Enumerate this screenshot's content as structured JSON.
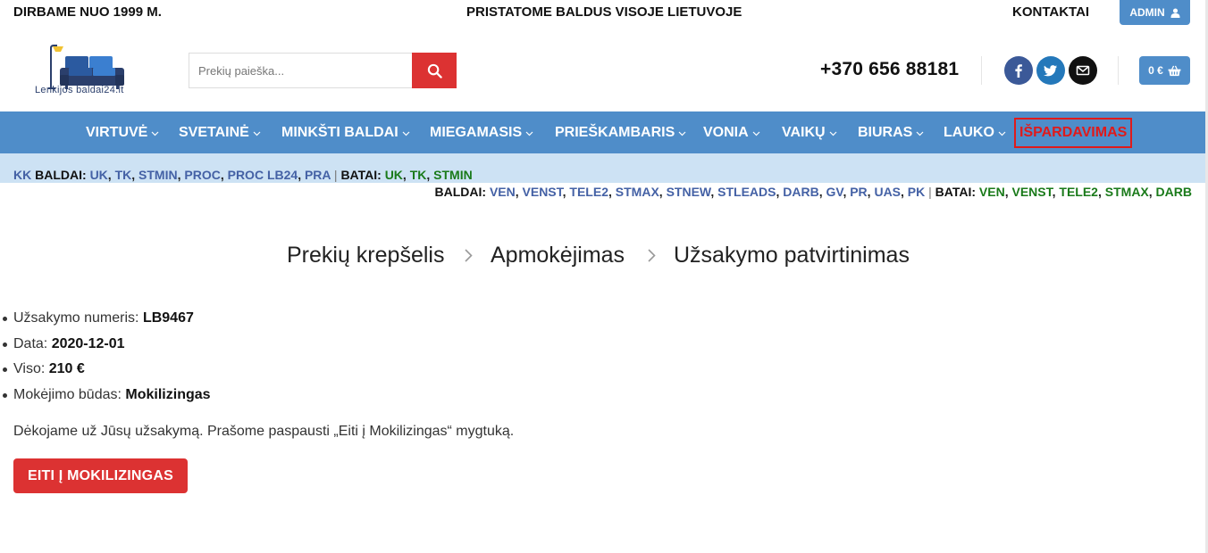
{
  "topbar": {
    "left_text": "DIRBAME NUO 1999 M.",
    "center_text": "PRISTATOME BALDUS VISOJE LIETUVOJE",
    "contacts_label": "KONTAKTAI",
    "admin_label": "ADMIN"
  },
  "header": {
    "logo_text": "Lenkijos baldai24.lt",
    "search_placeholder": "Prekių paieška...",
    "phone": "+370 656 88181",
    "cart_total": "0 €"
  },
  "nav": {
    "items": [
      {
        "label": "VIRTUVĖ"
      },
      {
        "label": "SVETAINĖ"
      },
      {
        "label": "MINKŠTI BALDAI"
      },
      {
        "label": "MIEGAMASIS"
      },
      {
        "label": "PRIEŠKAMBARIS"
      },
      {
        "label": "VONIA"
      },
      {
        "label": "VAIKŲ"
      },
      {
        "label": "BIURAS"
      },
      {
        "label": "LAUKO"
      }
    ],
    "sale_label": "IŠPARDAVIMAS"
  },
  "admin_links": {
    "row1": {
      "prefix": "KK",
      "baldai_label": "BALDAI:",
      "baldai_links": [
        "UK",
        "TK",
        "STMIN",
        "PROC",
        "PROC LB24",
        "PRA"
      ],
      "batai_label": "BATAI:",
      "batai_links": [
        "UK",
        "TK",
        "STMIN"
      ]
    },
    "row2": {
      "baldai_label": "BALDAI:",
      "baldai_links": [
        "VEN",
        "VENST",
        "TELE2",
        "STMAX",
        "STNEW",
        "STLEADS",
        "DARB",
        "GV",
        "PR",
        "UAS",
        "PK"
      ],
      "batai_label": "BATAI:",
      "batai_links": [
        "VEN",
        "VENST",
        "TELE2",
        "STMAX",
        "DARB"
      ]
    }
  },
  "checkout_steps": {
    "step1": "Prekių krepšelis",
    "step2": "Apmokėjimas",
    "step3": "Užsakymo patvirtinimas"
  },
  "order": {
    "number_label": "Užsakymo numeris:",
    "number_value": "LB9467",
    "date_label": "Data:",
    "date_value": "2020-12-01",
    "total_label": "Viso:",
    "total_value": "210 €",
    "method_label": "Mokėjimo būdas:",
    "method_value": "Mokilizingas",
    "thanks_text": "Dėkojame už Jūsų užsakymą. Prašome paspausti „Eiti į Mokilizingas“ mygtuką.",
    "pay_button": "EITI Į MOKILIZINGAS"
  },
  "colors": {
    "nav_blue": "#4f8dc9",
    "strip_blue": "#cde2f4",
    "accent_red": "#dc3232",
    "link_blue": "#4461a5",
    "link_green": "#1a7a1a"
  }
}
